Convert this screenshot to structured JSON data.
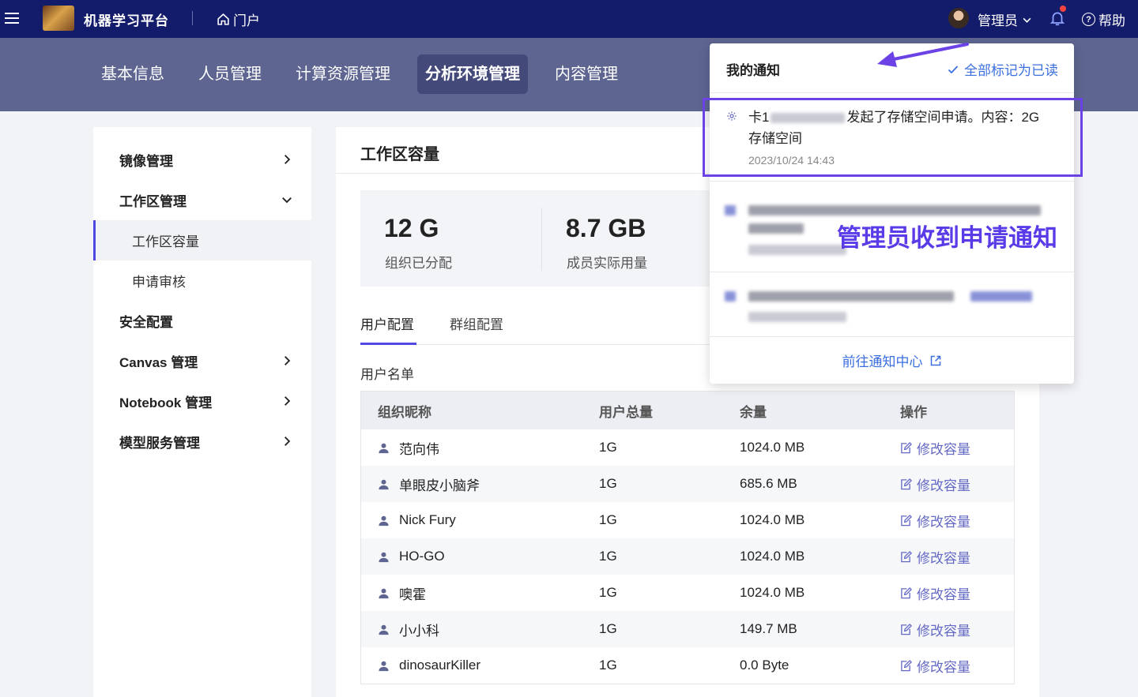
{
  "topbar": {
    "app_title": "机器学习平台",
    "portal_label": "门户",
    "user_label": "管理员",
    "help_label": "帮助",
    "icons": [
      "menu-icon",
      "home-icon",
      "chevron-down-icon",
      "bell-icon",
      "help-icon"
    ]
  },
  "tabs": [
    {
      "label": "基本信息"
    },
    {
      "label": "人员管理"
    },
    {
      "label": "计算资源管理"
    },
    {
      "label": "分析环境管理",
      "active": true
    },
    {
      "label": "内容管理"
    }
  ],
  "sidebar": {
    "items": [
      {
        "label": "镜像管理"
      },
      {
        "label": "工作区管理"
      },
      {
        "label": "工作区容量"
      },
      {
        "label": "申请审核"
      },
      {
        "label": "安全配置"
      },
      {
        "label": "Canvas 管理"
      },
      {
        "label": "Notebook 管理"
      },
      {
        "label": "模型服务管理"
      }
    ]
  },
  "main": {
    "title": "工作区容量",
    "stats": [
      {
        "value": "12 G",
        "label": "组织已分配"
      },
      {
        "value": "8.7 GB",
        "label": "成员实际用量"
      }
    ],
    "subtabs": [
      "用户配置",
      "群组配置"
    ],
    "list_title": "用户名单",
    "table": {
      "headers": [
        "组织昵称",
        "用户总量",
        "余量",
        "操作"
      ],
      "action_label": "修改容量",
      "rows": [
        {
          "name": "范向伟",
          "total": "1G",
          "remain": "1024.0 MB"
        },
        {
          "name": "单眼皮小脑斧",
          "total": "1G",
          "remain": "685.6 MB"
        },
        {
          "name": "Nick Fury",
          "total": "1G",
          "remain": "1024.0 MB"
        },
        {
          "name": "HO-GO",
          "total": "1G",
          "remain": "1024.0 MB"
        },
        {
          "name": "噢霍",
          "total": "1G",
          "remain": "1024.0 MB"
        },
        {
          "name": "小小科",
          "total": "1G",
          "remain": "149.7 MB"
        },
        {
          "name": "dinosaurKiller",
          "total": "1G",
          "remain": "0.0 Byte"
        }
      ]
    }
  },
  "notifications": {
    "title": "我的通知",
    "mark_all_read": "全部标记为已读",
    "item1_prefix": "卡1",
    "item1_suffix": "发起了存储空间申请。内容：2G",
    "item1_line2": "存储空间",
    "item1_time": "2023/10/24 14:43",
    "footer_link": "前往通知中心"
  },
  "annotation_text": "管理员收到申请通知",
  "colors": {
    "topbar": "#131b6b",
    "accent": "#5147e5",
    "link": "#3b6fe0",
    "annotation": "#5b3ae8"
  }
}
